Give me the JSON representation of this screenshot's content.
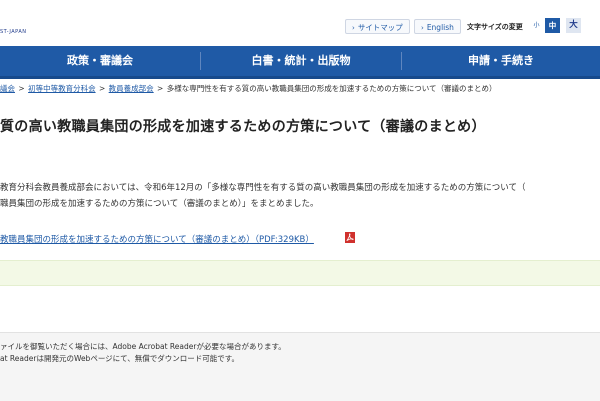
{
  "header": {
    "logo_text": "ST-JAPAN",
    "sitemap_label": "サイトマップ",
    "english_label": "English",
    "text_size_label": "文字サイズの変更",
    "size_small": "小",
    "size_mid": "中",
    "size_big": "大"
  },
  "nav": {
    "items": [
      "政策・審議会",
      "白書・統計・出版物",
      "申請・手続き"
    ]
  },
  "breadcrumb": {
    "items": [
      "議会",
      "初等中等教育分科会",
      "教員養成部会"
    ],
    "current": "多様な専門性を有する質の高い教職員集団の形成を加速するための方策について（審議のまとめ）",
    "separator": ">"
  },
  "main": {
    "title": "質の高い教職員集団の形成を加速するための方策について（審議のまとめ）",
    "paragraph_line1": "教育分科会教員養成部会においては、令和6年12月の「多様な専門性を有する質の高い教職員集団の形成を加速するための方策について（",
    "paragraph_line2": "職員集団の形成を加速するための方策について（審議のまとめ）」をまとめました。",
    "pdf_link": "教職員集団の形成を加速するための方策について（審議のまとめ）（PDF:329KB）",
    "pdf_icon": "pdf-icon"
  },
  "notice": {
    "line1": "ァイルを御覧いただく場合には、Adobe Acrobat Readerが必要な場合があります。",
    "line2": "at Readerは開発元のWebページにて、無償でダウンロード可能です。"
  },
  "colors": {
    "nav_bg": "#1f5aa6",
    "link": "#1f5aa6",
    "band_bg": "#f3f9e6",
    "pdf_red": "#d0312d"
  }
}
